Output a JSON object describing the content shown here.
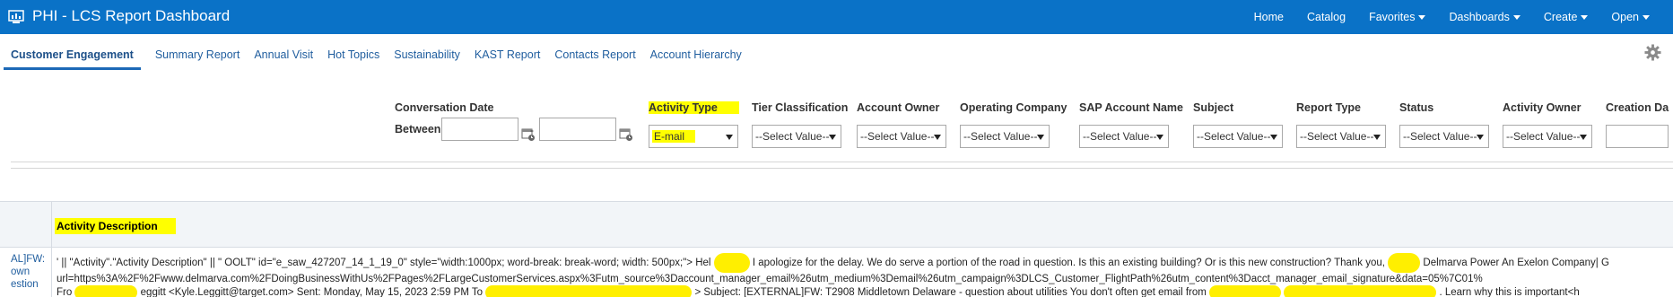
{
  "app": {
    "title": "PHI - LCS Report Dashboard",
    "icon": "dashboard-icon",
    "accent_color": "#0a72c7"
  },
  "topnav": [
    {
      "label": "Home",
      "has_menu": false
    },
    {
      "label": "Catalog",
      "has_menu": false
    },
    {
      "label": "Favorites",
      "has_menu": true
    },
    {
      "label": "Dashboards",
      "has_menu": true
    },
    {
      "label": "Create",
      "has_menu": true
    },
    {
      "label": "Open",
      "has_menu": true
    }
  ],
  "tabs": [
    {
      "label": "Customer Engagement",
      "active": true
    },
    {
      "label": "Summary Report",
      "active": false
    },
    {
      "label": "Annual Visit",
      "active": false
    },
    {
      "label": "Hot Topics",
      "active": false
    },
    {
      "label": "Sustainability",
      "active": false
    },
    {
      "label": "KAST Report",
      "active": false
    },
    {
      "label": "Contacts Report",
      "active": false
    },
    {
      "label": "Account Hierarchy",
      "active": false
    }
  ],
  "filters": {
    "conversation_date": {
      "label": "Conversation Date",
      "operator": "Between",
      "from": "",
      "to": "",
      "separator": "-"
    },
    "activity_type": {
      "label": "Activity Type",
      "value": "E-mail"
    },
    "tier_classification": {
      "label": "Tier Classification",
      "value": "--Select Value--"
    },
    "account_owner": {
      "label": "Account Owner",
      "value": "--Select Value--"
    },
    "operating_company": {
      "label": "Operating Company",
      "value": "--Select Value--"
    },
    "sap_account_name": {
      "label": "SAP Account Name",
      "value": "--Select Value--"
    },
    "subject": {
      "label": "Subject",
      "value": "--Select Value--"
    },
    "report_type": {
      "label": "Report Type",
      "value": "--Select Value--"
    },
    "status": {
      "label": "Status",
      "value": "--Select Value--"
    },
    "activity_owner": {
      "label": "Activity Owner",
      "value": "--Select Value--"
    },
    "creation_date": {
      "label": "Creation Da",
      "value": ""
    }
  },
  "results": {
    "column_header": "Activity Description",
    "left_cell_lines": [
      "AL]FW:",
      "own",
      "estion"
    ],
    "description_lines": [
      "' || \"Activity\".\"Activity Description\" || \" OOLT\" id=\"e_saw_427207_14_1_19_0\" style=\"width:1000px; word-break: break-word; width: 500px;\"> Hel",
      "I apologize for the delay. We do serve a portion of the road in question. Is this an existing building? Or is this new construction? Thank you,",
      "Delmarva Power An Exelon Company| G",
      "url=https%3A%2F%2Fwww.delmarva.com%2FDoingBusinessWithUs%2FPages%2FLargeCustomerServices.aspx%3Futm_source%3Daccount_manager_email%26utm_medium%3Demail%26utm_campaign%3DLCS_Customer_FlightPath%26utm_content%3Dacct_manager_email_signature&data=05%7C01%",
      "Fro",
      "eggitt <Kyle.Leggitt@target.com> Sent: Monday, May 15, 2023 2:59 PM To",
      "> Subject: [EXTERNAL]FW: T2908 Middletown Delaware - question about utilities You don't often get email from",
      ". Learn why this is important<h"
    ]
  },
  "highlight_color": "#ffff00"
}
